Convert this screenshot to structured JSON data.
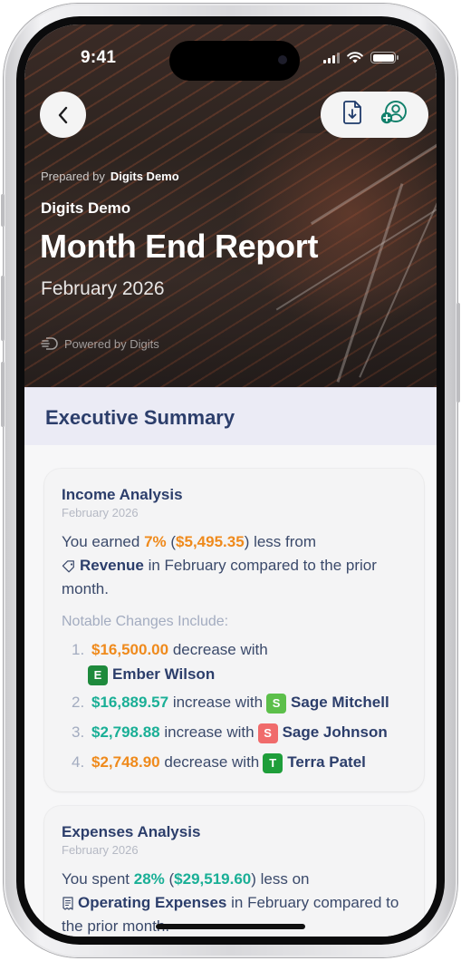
{
  "status_bar": {
    "time": "9:41"
  },
  "header": {
    "prepared_by_label": "Prepared by",
    "prepared_by_name": "Digits Demo",
    "company": "Digits Demo",
    "title": "Month End Report",
    "period": "February 2026",
    "powered_by": "Powered by Digits"
  },
  "section": {
    "title": "Executive Summary"
  },
  "income": {
    "title": "Income Analysis",
    "period": "February 2026",
    "text_1": "You earned ",
    "percent": "7%",
    "text_2": " (",
    "amount": "$5,495.35",
    "text_3": ") less from",
    "category": "Revenue",
    "text_4": " in February compared to the prior month.",
    "notable_label": "Notable Changes Include:",
    "changes": [
      {
        "num": "1.",
        "amount": "$16,500.00",
        "text": " decrease with",
        "initial": "E",
        "name": "Ember Wilson",
        "badge_color": "#1e8a3c",
        "amount_color": "#ef8a1c"
      },
      {
        "num": "2.",
        "amount": "$16,889.57",
        "text": " increase with",
        "initial": "S",
        "name": "Sage Mitchell",
        "badge_color": "#5cbf4a",
        "amount_color": "#1aaf96"
      },
      {
        "num": "3.",
        "amount": "$2,798.88",
        "text": " increase with",
        "initial": "S",
        "name": "Sage Johnson",
        "badge_color": "#f06b6b",
        "amount_color": "#1aaf96"
      },
      {
        "num": "4.",
        "amount": "$2,748.90",
        "text": " decrease with",
        "initial": "T",
        "name": "Terra Patel",
        "badge_color": "#1e9e3a",
        "amount_color": "#ef8a1c"
      }
    ]
  },
  "expenses": {
    "title": "Expenses Analysis",
    "period": "February 2026",
    "text_1": "You spent ",
    "percent": "28%",
    "text_2": " (",
    "amount": "$29,519.60",
    "text_3": ") less on",
    "category": "Operating Expenses",
    "text_4": " in February compared to the prior month."
  },
  "icons": {
    "back": "chevron-left-icon",
    "download": "document-download-icon",
    "share": "add-user-icon",
    "tag": "tag-icon",
    "receipt": "receipt-icon",
    "digits_logo": "digits-logo-icon"
  }
}
